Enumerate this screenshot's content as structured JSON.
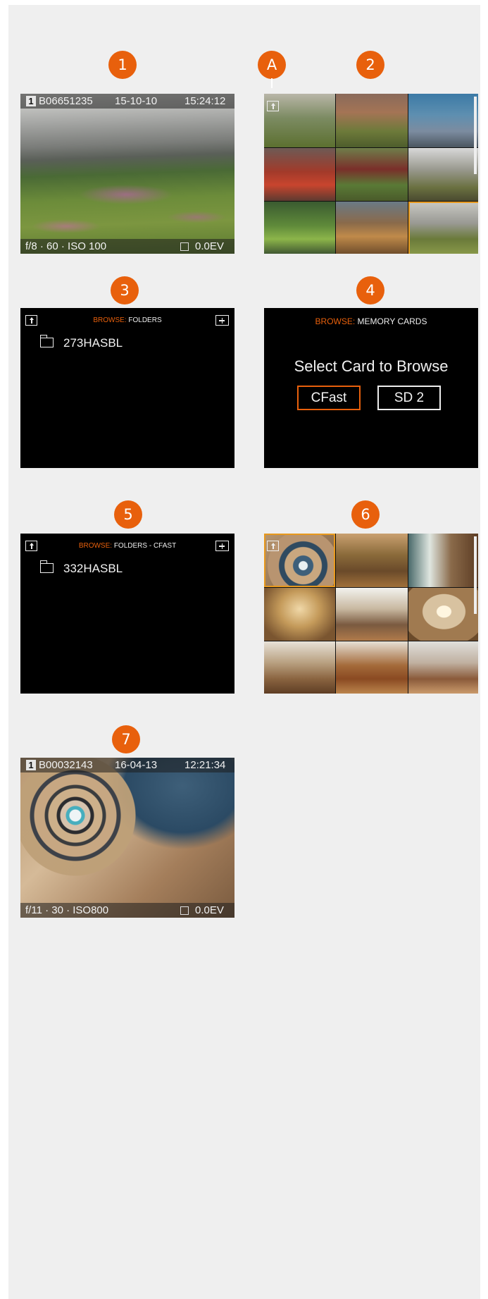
{
  "badges": [
    "1",
    "A",
    "2",
    "3",
    "4",
    "5",
    "6",
    "7"
  ],
  "screen1": {
    "card_slot": "1",
    "filename": "B06651235",
    "date": "15-10-10",
    "time": "15:24:12",
    "exposure_left": "f/8 · 60 · ISO 100",
    "ev": "0.0EV"
  },
  "screen3": {
    "title_accent": "BROWSE: ",
    "title_rest": "FOLDERS",
    "folder": "273HASBL"
  },
  "screen4": {
    "title_accent": "BROWSE: ",
    "title_rest": "MEMORY CARDS",
    "prompt": "Select Card to Browse",
    "options": [
      "CFast",
      "SD 2"
    ]
  },
  "screen5": {
    "title_accent": "BROWSE: ",
    "title_rest": "FOLDERS - CFAST",
    "folder": "332HASBL"
  },
  "screen7": {
    "card_slot": "1",
    "filename": "B00032143",
    "date": "16-04-13",
    "time": "12:21:34",
    "exposure_left": "f/11 · 30 · ISO800",
    "ev": "0.0EV"
  },
  "colors": {
    "accent": "#e8600c",
    "selection": "#e8991d",
    "background": "#efefef"
  },
  "icons": [
    "up-folder-icon",
    "new-folder-icon",
    "folder-icon",
    "exposure-comp-icon",
    "card-slot-icon"
  ]
}
